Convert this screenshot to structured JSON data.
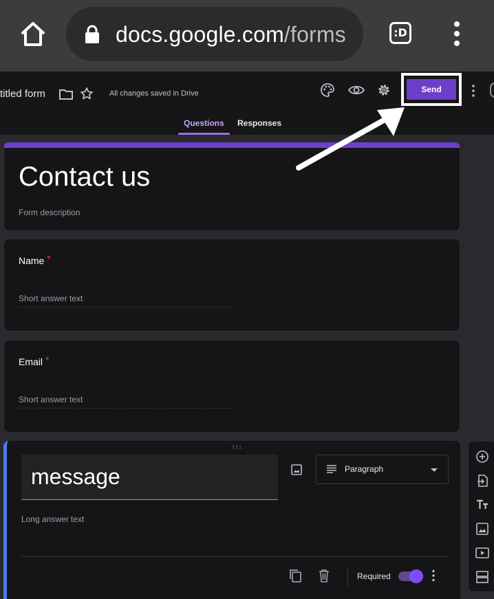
{
  "browser": {
    "url_host": "docs.google.com",
    "url_path": "/forms",
    "tab_switcher_label": ":D"
  },
  "header": {
    "form_title": "titled form",
    "save_status": "All changes saved in Drive",
    "send_label": "Send",
    "tabs": [
      {
        "label": "Questions",
        "active": true
      },
      {
        "label": "Responses",
        "active": false
      }
    ]
  },
  "title_card": {
    "title": "Contact us",
    "description": "Form description"
  },
  "questions": [
    {
      "title": "Name",
      "required_mark": "*",
      "hint": "Short answer text"
    },
    {
      "title": "Email",
      "required_mark": "*",
      "hint": "Short answer text"
    }
  ],
  "active_question": {
    "title": "message",
    "type": "Paragraph",
    "hint": "Long answer text",
    "required_label": "Required",
    "required": true
  },
  "toolbar_items": [
    "add-question-icon",
    "import-questions-icon",
    "add-title-icon",
    "add-image-icon",
    "add-video-icon",
    "add-section-icon"
  ],
  "colors": {
    "accent": "#6c3fc7",
    "active_border": "#4a7df0",
    "required": "#e53935"
  }
}
